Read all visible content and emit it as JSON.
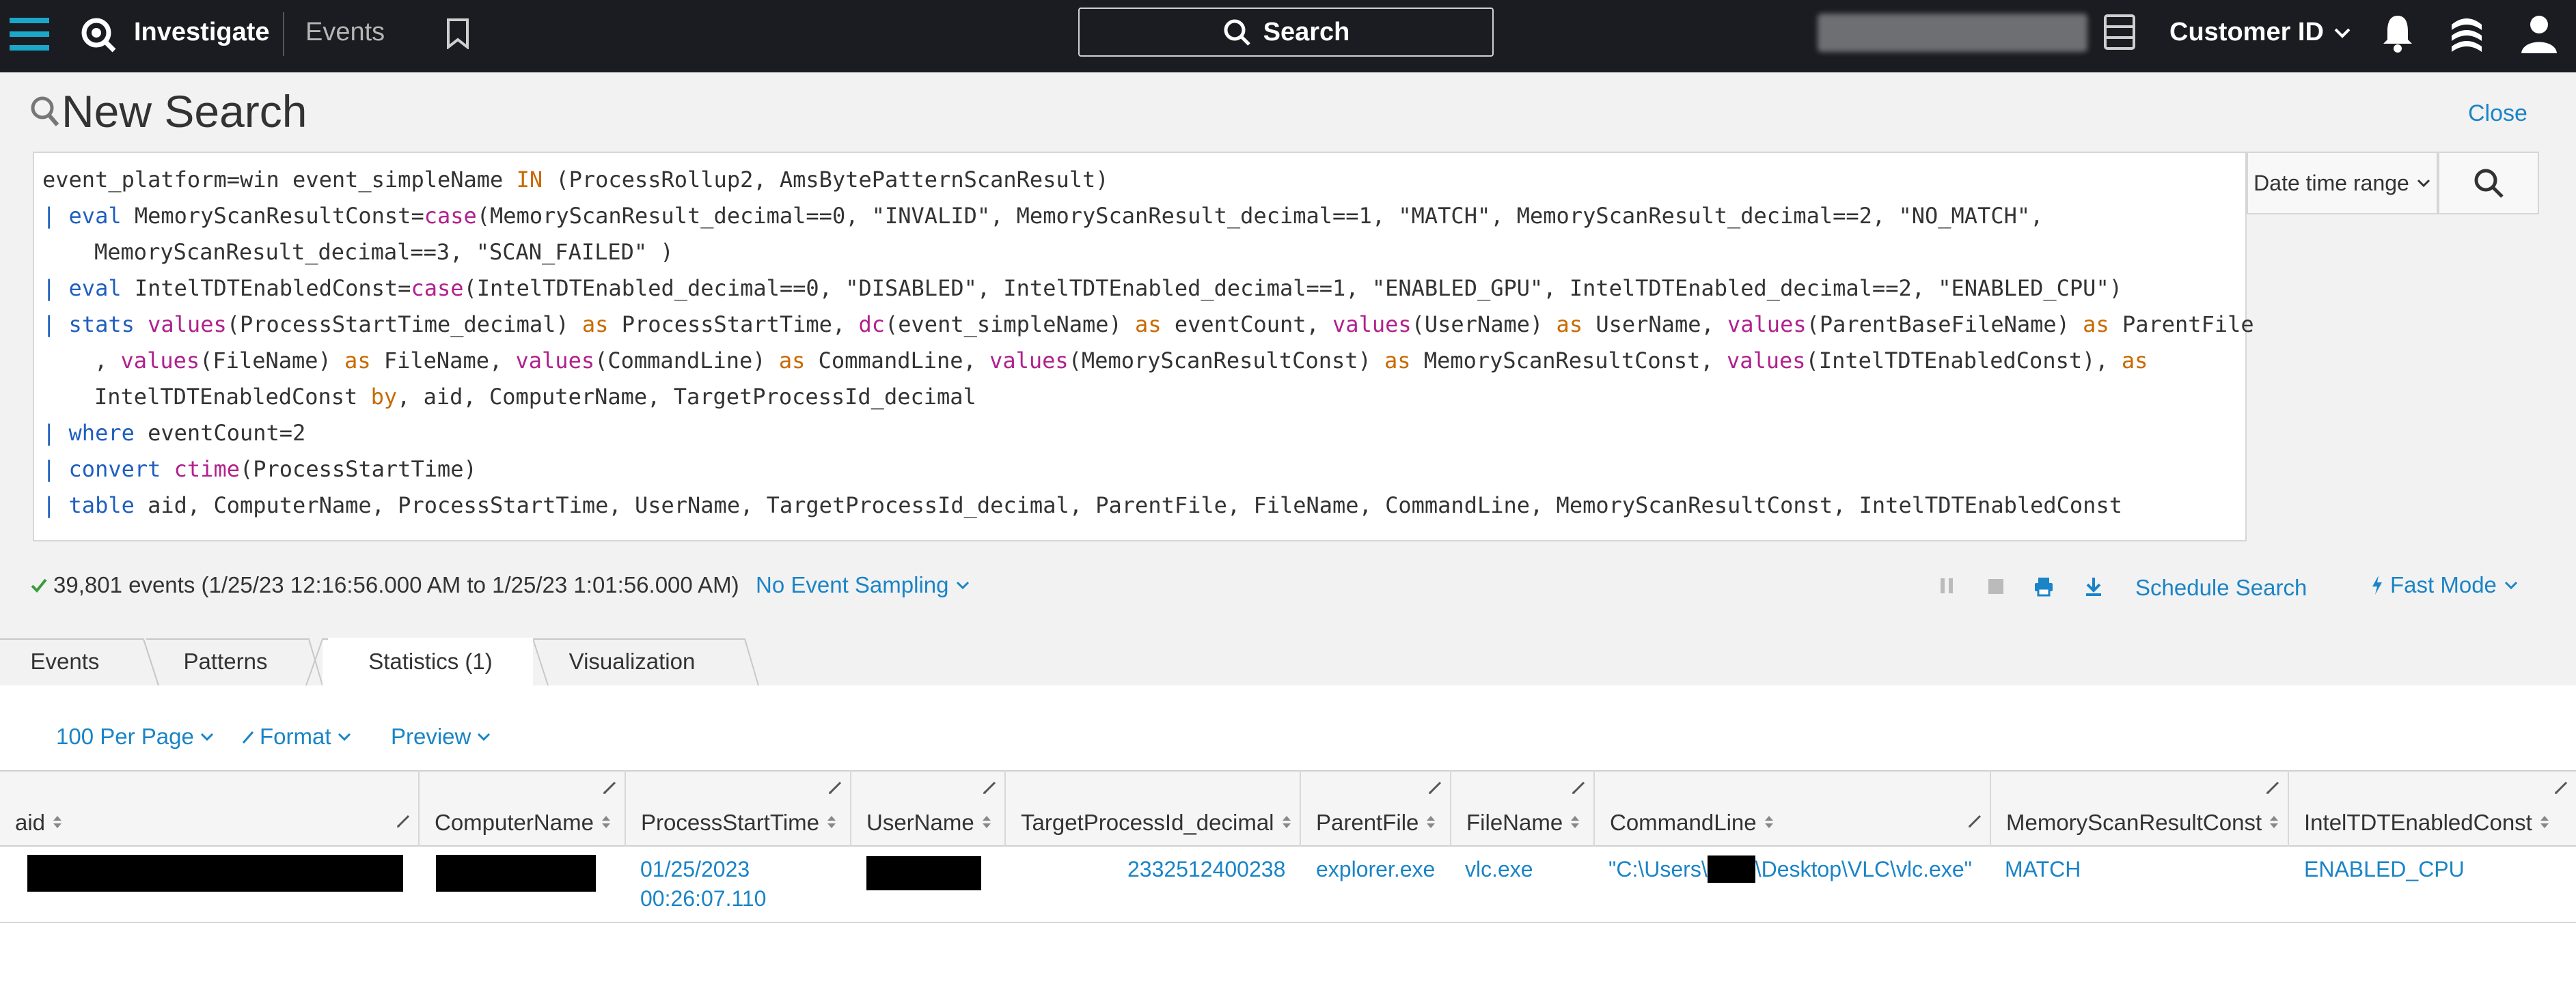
{
  "topbar": {
    "product": "Investigate",
    "section": "Events",
    "search_label": "Search",
    "customer_label": "Customer ID"
  },
  "search": {
    "title": "New Search",
    "close_label": "Close",
    "date_range_label": "Date time range",
    "query_lines": [
      "event_platform=win event_simpleName IN (ProcessRollup2, AmsBytePatternScanResult)",
      "| eval MemoryScanResultConst=case(MemoryScanResult_decimal==0, \"INVALID\", MemoryScanResult_decimal==1, \"MATCH\", MemoryScanResult_decimal==2, \"NO_MATCH\",",
      "MemoryScanResult_decimal==3, \"SCAN_FAILED\" )",
      "| eval IntelTDTEnabledConst=case(IntelTDTEnabled_decimal==0, \"DISABLED\", IntelTDTEnabled_decimal==1, \"ENABLED_GPU\", IntelTDTEnabled_decimal==2, \"ENABLED_CPU\")",
      "| stats values(ProcessStartTime_decimal) as ProcessStartTime, dc(event_simpleName) as eventCount, values(UserName) as UserName, values(ParentBaseFileName) as ParentFile",
      ", values(FileName) as FileName, values(CommandLine) as CommandLine, values(MemoryScanResultConst) as MemoryScanResultConst, values(IntelTDTEnabledConst), as",
      "IntelTDTEnabledConst by, aid, ComputerName, TargetProcessId_decimal",
      "| where eventCount=2",
      "| convert ctime(ProcessStartTime)",
      "| table aid, ComputerName, ProcessStartTime, UserName, TargetProcessId_decimal, ParentFile, FileName, CommandLine, MemoryScanResultConst, IntelTDTEnabledConst"
    ]
  },
  "status": {
    "summary": "39,801 events (1/25/23 12:16:56.000 AM to 1/25/23 1:01:56.000 AM)",
    "sampling": "No Event Sampling",
    "schedule": "Schedule Search",
    "mode": "Fast Mode"
  },
  "tabs": [
    {
      "label": "Events"
    },
    {
      "label": "Patterns"
    },
    {
      "label": "Statistics (1)",
      "active": true
    },
    {
      "label": "Visualization"
    }
  ],
  "controls": {
    "per_page": "100 Per Page",
    "format": "Format",
    "preview": "Preview"
  },
  "table": {
    "columns": [
      "aid",
      "ComputerName",
      "ProcessStartTime",
      "UserName",
      "TargetProcessId_decimal",
      "ParentFile",
      "FileName",
      "CommandLine",
      "MemoryScanResultConst",
      "IntelTDTEnabledConst"
    ],
    "row": {
      "process_start_date": "01/25/2023",
      "process_start_time": "00:26:07.110",
      "target_pid": "2332512400238",
      "parent_file": "explorer.exe",
      "file_name": "vlc.exe",
      "cmd_prefix": "\"C:\\Users\\",
      "cmd_suffix": "\\Desktop\\VLC\\vlc.exe\"",
      "memory_scan": "MATCH",
      "intel_tdt": "ENABLED_CPU"
    }
  },
  "colors": {
    "accent": "#1a84c7",
    "topbar_bg": "#1a1c21",
    "logo_accent": "#1aa7c9"
  }
}
